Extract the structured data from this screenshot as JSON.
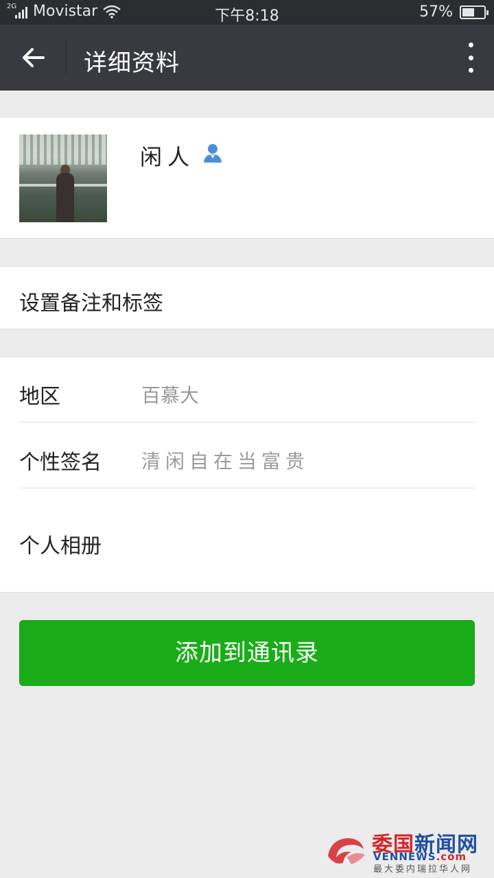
{
  "status_bar": {
    "network": "2G",
    "carrier": "Movistar",
    "time": "下午8:18",
    "battery_percent": "57%",
    "battery_level": 0.57
  },
  "title_bar": {
    "title": "详细资料",
    "back_icon": "arrow-left-icon",
    "more_icon": "more-vertical-icon"
  },
  "profile": {
    "name": "闲人",
    "badge_icon": "contact-person-icon",
    "accent_color": "#4a90d9"
  },
  "remark": {
    "label": "设置备注和标签"
  },
  "info": {
    "region_label": "地区",
    "region_value": "百慕大",
    "signature_label": "个性签名",
    "signature_value": "清闲自在当富贵",
    "album_label": "个人相册"
  },
  "add_button": {
    "label": "添加到通讯录",
    "color": "#1aad19"
  },
  "watermark": {
    "title_red": "委国",
    "title_blue": "新闻网",
    "site_blue": "VENNEWS",
    "site_red": ".com",
    "subtitle": "最大委内瑞拉华人网"
  }
}
